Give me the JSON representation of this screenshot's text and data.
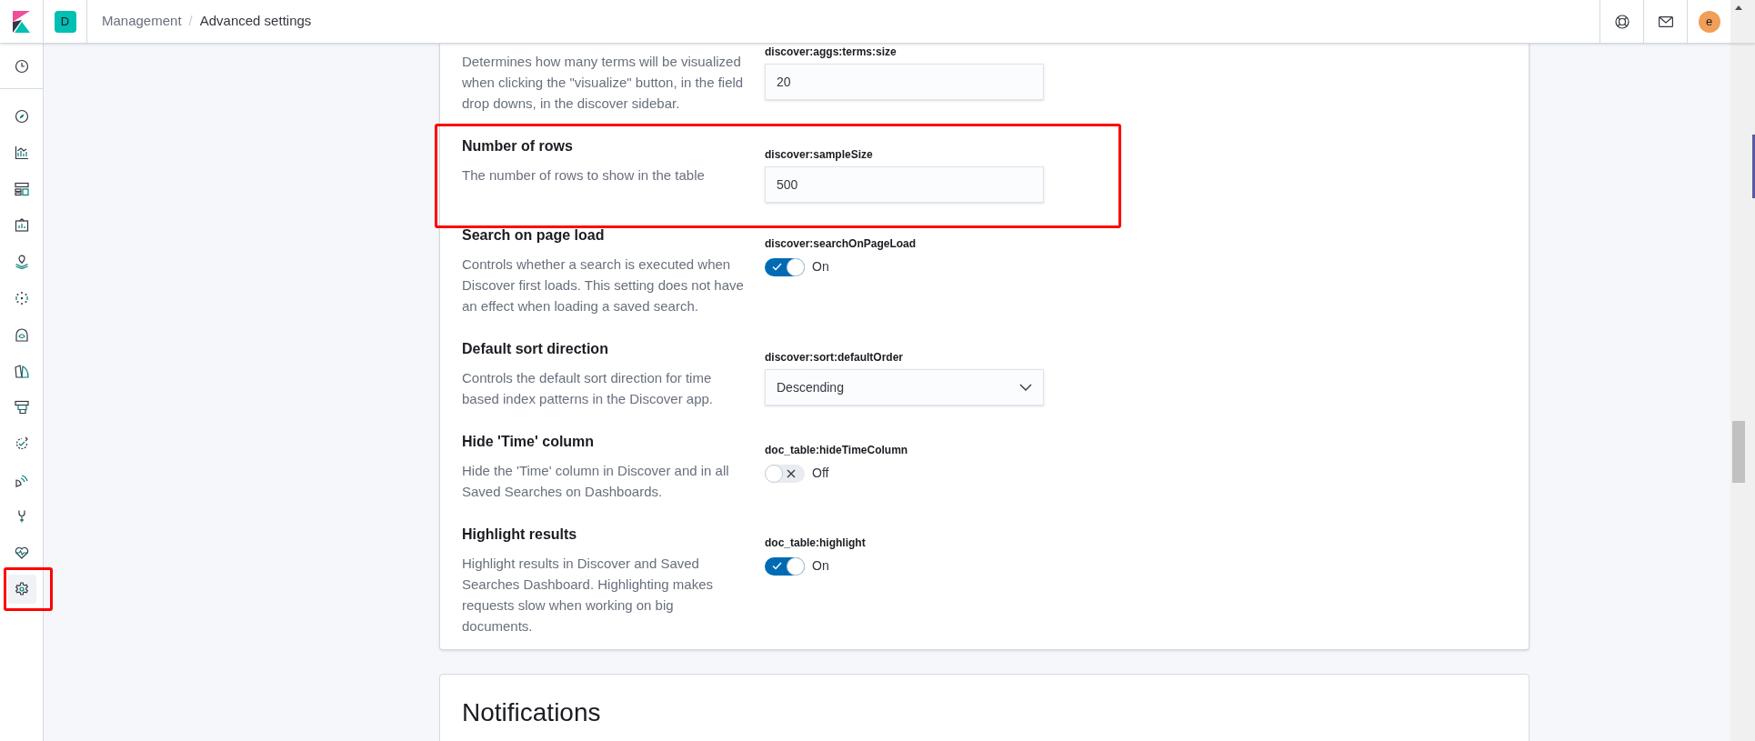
{
  "header": {
    "space_badge": "D",
    "breadcrumbs": [
      {
        "label": "Management",
        "current": false
      },
      {
        "label": "Advanced settings",
        "current": true
      }
    ],
    "breadcrumb_separator": "/",
    "avatar": "e"
  },
  "sidebar": {
    "items": [
      {
        "kind": "clock",
        "selected": false,
        "highlighted": false
      },
      {
        "kind": "compass",
        "selected": false,
        "highlighted": false
      },
      {
        "kind": "chart",
        "selected": false,
        "highlighted": false
      },
      {
        "kind": "dashboard",
        "selected": false,
        "highlighted": false
      },
      {
        "kind": "canvas",
        "selected": false,
        "highlighted": false
      },
      {
        "kind": "map",
        "selected": false,
        "highlighted": false
      },
      {
        "kind": "graph",
        "selected": false,
        "highlighted": false
      },
      {
        "kind": "head",
        "selected": false,
        "highlighted": false
      },
      {
        "kind": "pages",
        "selected": false,
        "highlighted": false
      },
      {
        "kind": "monitor",
        "selected": false,
        "highlighted": false
      },
      {
        "kind": "uptime",
        "selected": false,
        "highlighted": false
      },
      {
        "kind": "signal",
        "selected": false,
        "highlighted": false
      },
      {
        "kind": "wrench",
        "selected": false,
        "highlighted": false
      },
      {
        "kind": "heart",
        "selected": false,
        "highlighted": false
      },
      {
        "kind": "gear",
        "selected": true,
        "highlighted": true
      }
    ]
  },
  "settings": [
    {
      "kind": "text",
      "key": "discover:aggs:terms:size",
      "description": "Determines how many terms will be visualized when clicking the \"visualize\" button, in the field drop downs, in the discover sidebar.",
      "value": "20",
      "highlighted": false
    },
    {
      "kind": "text",
      "title": "Number of rows",
      "description": "The number of rows to show in the table",
      "key": "discover:sampleSize",
      "value": "500",
      "highlighted": true
    },
    {
      "kind": "toggle",
      "title": "Search on page load",
      "description": "Controls whether a search is executed when Discover first loads. This setting does not have an effect when loading a saved search.",
      "key": "discover:searchOnPageLoad",
      "on": true,
      "state_label": "On",
      "highlighted": false
    },
    {
      "kind": "select",
      "title": "Default sort direction",
      "description": "Controls the default sort direction for time based index patterns in the Discover app.",
      "key": "discover:sort:defaultOrder",
      "value": "Descending",
      "highlighted": false
    },
    {
      "kind": "toggle",
      "title": "Hide 'Time' column",
      "description": "Hide the 'Time' column in Discover and in all Saved Searches on Dashboards.",
      "key": "doc_table:hideTimeColumn",
      "on": false,
      "state_label": "Off",
      "highlighted": false
    },
    {
      "kind": "toggle",
      "title": "Highlight results",
      "description": "Highlight results in Discover and Saved Searches Dashboard. Highlighting makes requests slow when working on big documents.",
      "key": "doc_table:highlight",
      "on": true,
      "state_label": "On",
      "highlighted": false
    }
  ],
  "next_section": {
    "title": "Notifications"
  }
}
